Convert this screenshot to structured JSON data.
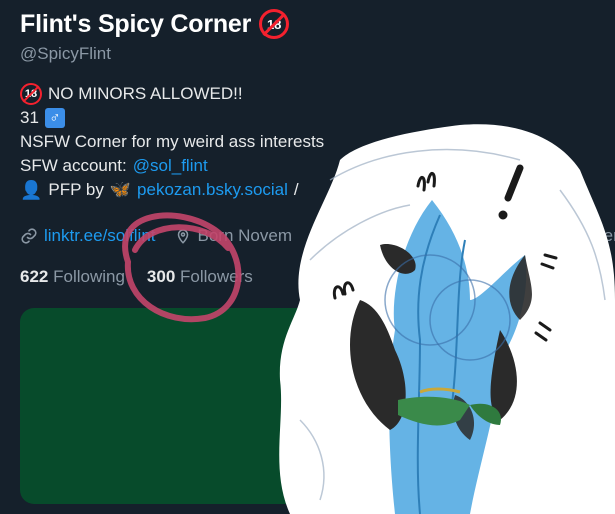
{
  "profile": {
    "display_name": "Flint's Spicy Corner",
    "badge_18": "18",
    "handle": "@SpicyFlint"
  },
  "bio": {
    "line1_badge": "18",
    "line1_text": "NO MINORS ALLOWED!!",
    "line2_age": "31",
    "line2_symbol": "♂",
    "line3": "NSFW Corner for my weird ass interests",
    "line4_prefix": "SFW account:",
    "line4_link": "@sol_flint",
    "line5_icon": "person-icon",
    "line5_prefix": "PFP by",
    "line5_icon2": "butterfly-icon",
    "line5_link": "pekozan.bsky.social",
    "line5_suffix": "/"
  },
  "meta": {
    "link_icon": "link-icon",
    "link_text": "linktr.ee/solflint",
    "location_icon": "location-pin-icon",
    "born_text": "Born Novem",
    "extra_text": "mber"
  },
  "stats": {
    "following_count": "622",
    "following_label": "Following",
    "followers_count": "300",
    "followers_label": "Followers"
  },
  "colors": {
    "background": "#15202b",
    "accent_link": "#1d9bf0",
    "banner_green": "#074b2b",
    "circle_highlight": "#c4456b"
  }
}
